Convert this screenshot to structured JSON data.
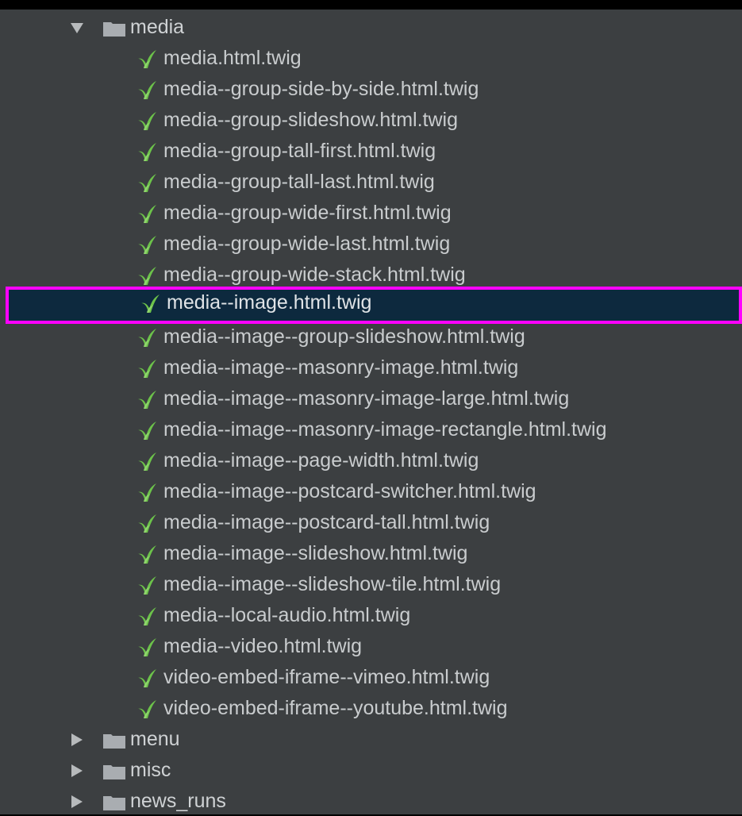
{
  "tree": {
    "open_folder": {
      "name": "media",
      "state": "expanded"
    },
    "files": [
      "media.html.twig",
      "media--group-side-by-side.html.twig",
      "media--group-slideshow.html.twig",
      "media--group-tall-first.html.twig",
      "media--group-tall-last.html.twig",
      "media--group-wide-first.html.twig",
      "media--group-wide-last.html.twig",
      "media--group-wide-stack.html.twig",
      "media--image.html.twig",
      "media--image--group-slideshow.html.twig",
      "media--image--masonry-image.html.twig",
      "media--image--masonry-image-large.html.twig",
      "media--image--masonry-image-rectangle.html.twig",
      "media--image--page-width.html.twig",
      "media--image--postcard-switcher.html.twig",
      "media--image--postcard-tall.html.twig",
      "media--image--slideshow.html.twig",
      "media--image--slideshow-tile.html.twig",
      "media--local-audio.html.twig",
      "media--video.html.twig",
      "video-embed-iframe--vimeo.html.twig",
      "video-embed-iframe--youtube.html.twig"
    ],
    "selected_file": "media--image.html.twig",
    "collapsed_folders": [
      "menu",
      "misc",
      "news_runs"
    ],
    "icons": {
      "expanded_arrow": "triangle-down-icon",
      "collapsed_arrow": "triangle-right-icon",
      "folder": "folder-icon",
      "file": "twig-file-icon"
    },
    "colors": {
      "panel_bg": "#3c3f41",
      "text": "#c9ccce",
      "selection_bg": "#0d293e",
      "highlight_border": "#ff00ff",
      "twig_green": "#6cc24a"
    }
  }
}
